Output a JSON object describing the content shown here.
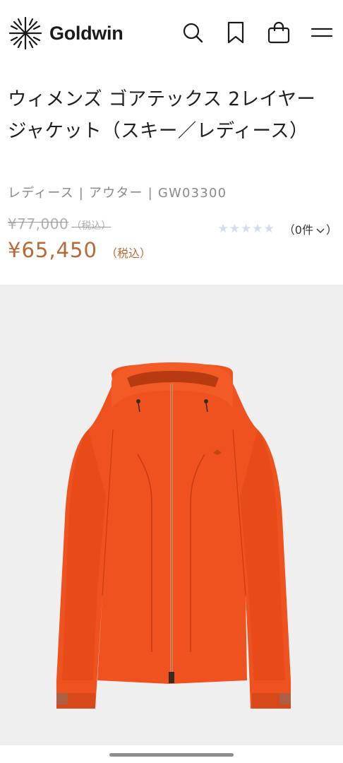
{
  "header": {
    "brand": "Goldwin",
    "icons": [
      "search-icon",
      "bookmark-icon",
      "cart-icon",
      "menu-icon"
    ]
  },
  "product": {
    "title": "ウィメンズ ゴアテックス 2レイヤー ジャケット（スキー／レディース）",
    "category": "レディース | アウター | GW03300",
    "original_price": "¥77,000",
    "original_tax_label": "（税込）",
    "price": "¥65,450",
    "price_tax_label": "（税込）",
    "rating_stars": 0,
    "rating_max": 5,
    "review_count": "（0件",
    "image_alt": "orange jacket"
  },
  "colors": {
    "price": "#b86a34",
    "old_price": "#b0b0b0",
    "stars_empty": "#d3dde9",
    "jacket": "#f0521f",
    "image_bg": "#efefef"
  }
}
